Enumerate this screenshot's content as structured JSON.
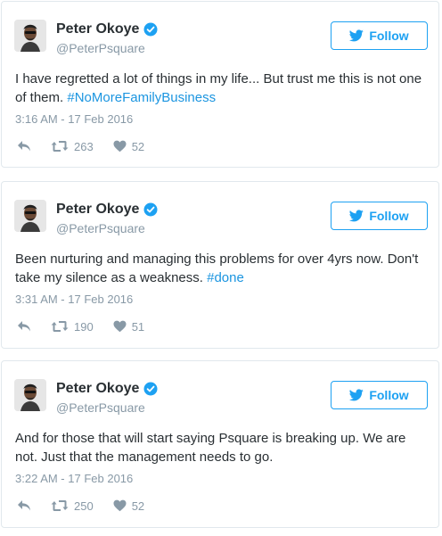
{
  "colors": {
    "accent": "#1da1f2",
    "hashtag": "#1b95e0",
    "meta": "#8899a6",
    "text": "#292f33",
    "border": "#e1e8ed"
  },
  "icons": {
    "reply": "reply-icon",
    "retweet": "retweet-icon",
    "like": "heart-icon",
    "verified": "verified-badge-icon",
    "follow": "twitter-bird-icon"
  },
  "tweets": [
    {
      "name": "Peter Okoye",
      "handle": "@PeterPsquare",
      "follow_label": "Follow",
      "text": "I have regretted a lot of things in my life... But trust me this is not one of them.",
      "hashtag": "#NoMoreFamilyBusiness",
      "time": "3:16 AM - 17 Feb 2016",
      "retweets": "263",
      "likes": "52"
    },
    {
      "name": "Peter Okoye",
      "handle": "@PeterPsquare",
      "follow_label": "Follow",
      "text": "Been nurturing and managing this problems for over 4yrs now. Don't take my silence as a weakness.",
      "hashtag": "#done",
      "time": "3:31 AM - 17 Feb 2016",
      "retweets": "190",
      "likes": "51"
    },
    {
      "name": "Peter Okoye",
      "handle": "@PeterPsquare",
      "follow_label": "Follow",
      "text": "And for those that will start saying Psquare is breaking up. We are not. Just that the management needs to go.",
      "hashtag": "",
      "time": "3:22 AM - 17 Feb 2016",
      "retweets": "250",
      "likes": "52"
    }
  ]
}
